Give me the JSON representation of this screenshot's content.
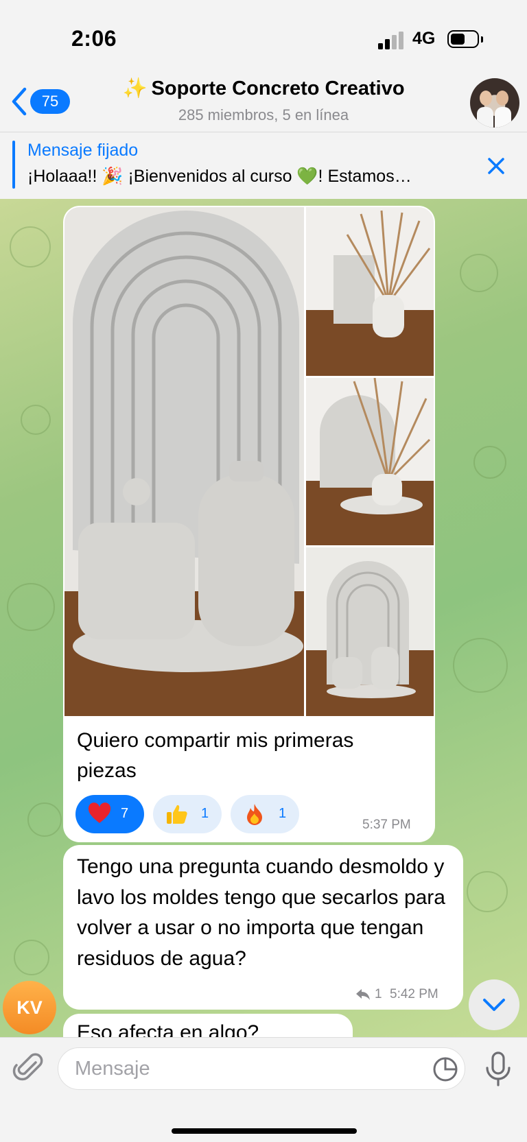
{
  "status_bar": {
    "time": "2:06",
    "network": "4G"
  },
  "header": {
    "back_badge": "75",
    "title_emoji": "✨",
    "title": "Soporte Concreto Creativo",
    "subtitle": "285 miembros, 5 en línea"
  },
  "pinned": {
    "label": "Mensaje fijado",
    "text": "¡Holaaa!! 🎉 ¡Bienvenidos al curso 💚! Estamos…"
  },
  "messages": [
    {
      "type": "album",
      "photo_count": 4,
      "caption": "Quiero compartir mis primeras piezas",
      "reactions": [
        {
          "emoji": "heart",
          "count": "7",
          "active": true
        },
        {
          "emoji": "thumbs-up",
          "count": "1",
          "active": false
        },
        {
          "emoji": "fire",
          "count": "1",
          "active": false
        }
      ],
      "time": "5:37 PM"
    },
    {
      "type": "text",
      "text": "Tengo una pregunta cuando desmoldo y lavo los moldes tengo que secarlos para volver a usar o no importa que tengan residuos de agua?",
      "reply_count": "1",
      "time": "5:42 PM"
    },
    {
      "type": "text",
      "text": "Eso afecta en algo?"
    }
  ],
  "sender": {
    "initials": "KV"
  },
  "composer": {
    "placeholder": "Mensaje"
  },
  "colors": {
    "accent": "#0a7aff",
    "chat_bg": "#9cc680",
    "avatar_kv": "#f48b25"
  }
}
